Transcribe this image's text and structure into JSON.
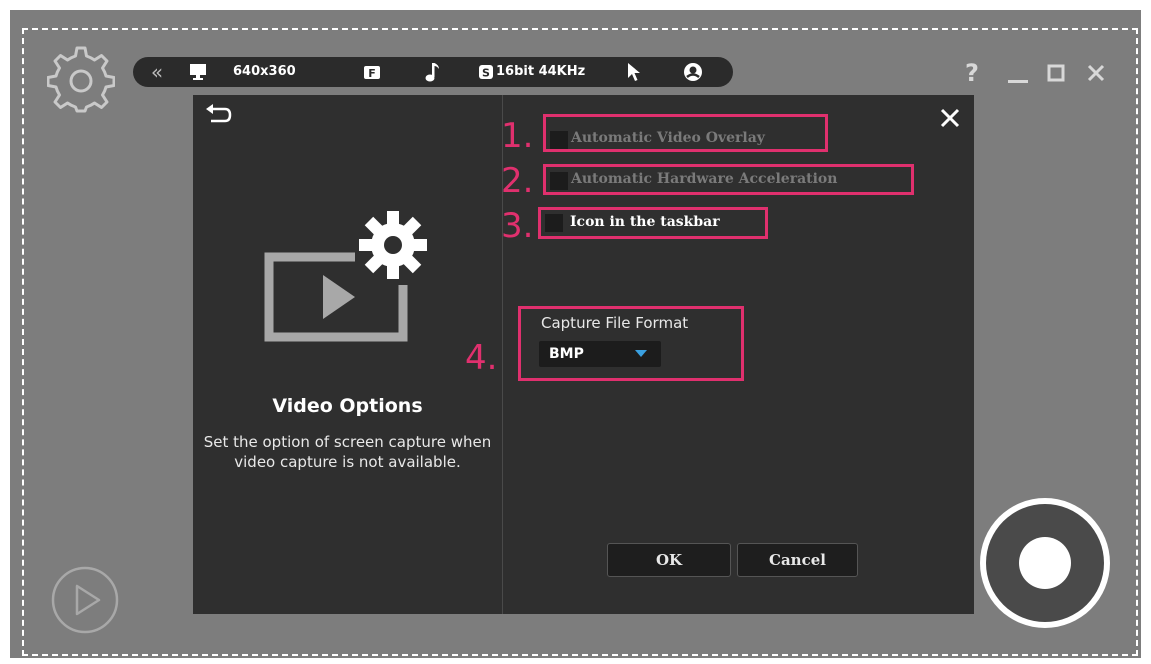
{
  "toolbar": {
    "resolution": "640x360",
    "audio": "16bit 44KHz"
  },
  "window": {
    "help": "?"
  },
  "dialog": {
    "title": "Video Options",
    "description": "Set the option of screen capture when video capture is not available.",
    "options": [
      {
        "number": "1.",
        "label": "Automatic Video Overlay",
        "checked": false,
        "enabled": false
      },
      {
        "number": "2.",
        "label": "Automatic Hardware Acceleration",
        "checked": false,
        "enabled": false
      },
      {
        "number": "3.",
        "label": "Icon in the taskbar",
        "checked": false,
        "enabled": true
      }
    ],
    "format": {
      "number": "4.",
      "label": "Capture File Format",
      "value": "BMP"
    },
    "ok_label": "OK",
    "cancel_label": "Cancel"
  },
  "colors": {
    "highlight": "#e0306e",
    "dialog_bg": "#2f2f2f",
    "frame_bg": "#7d7d7d",
    "dropdown_arrow": "#3aa0e0"
  }
}
